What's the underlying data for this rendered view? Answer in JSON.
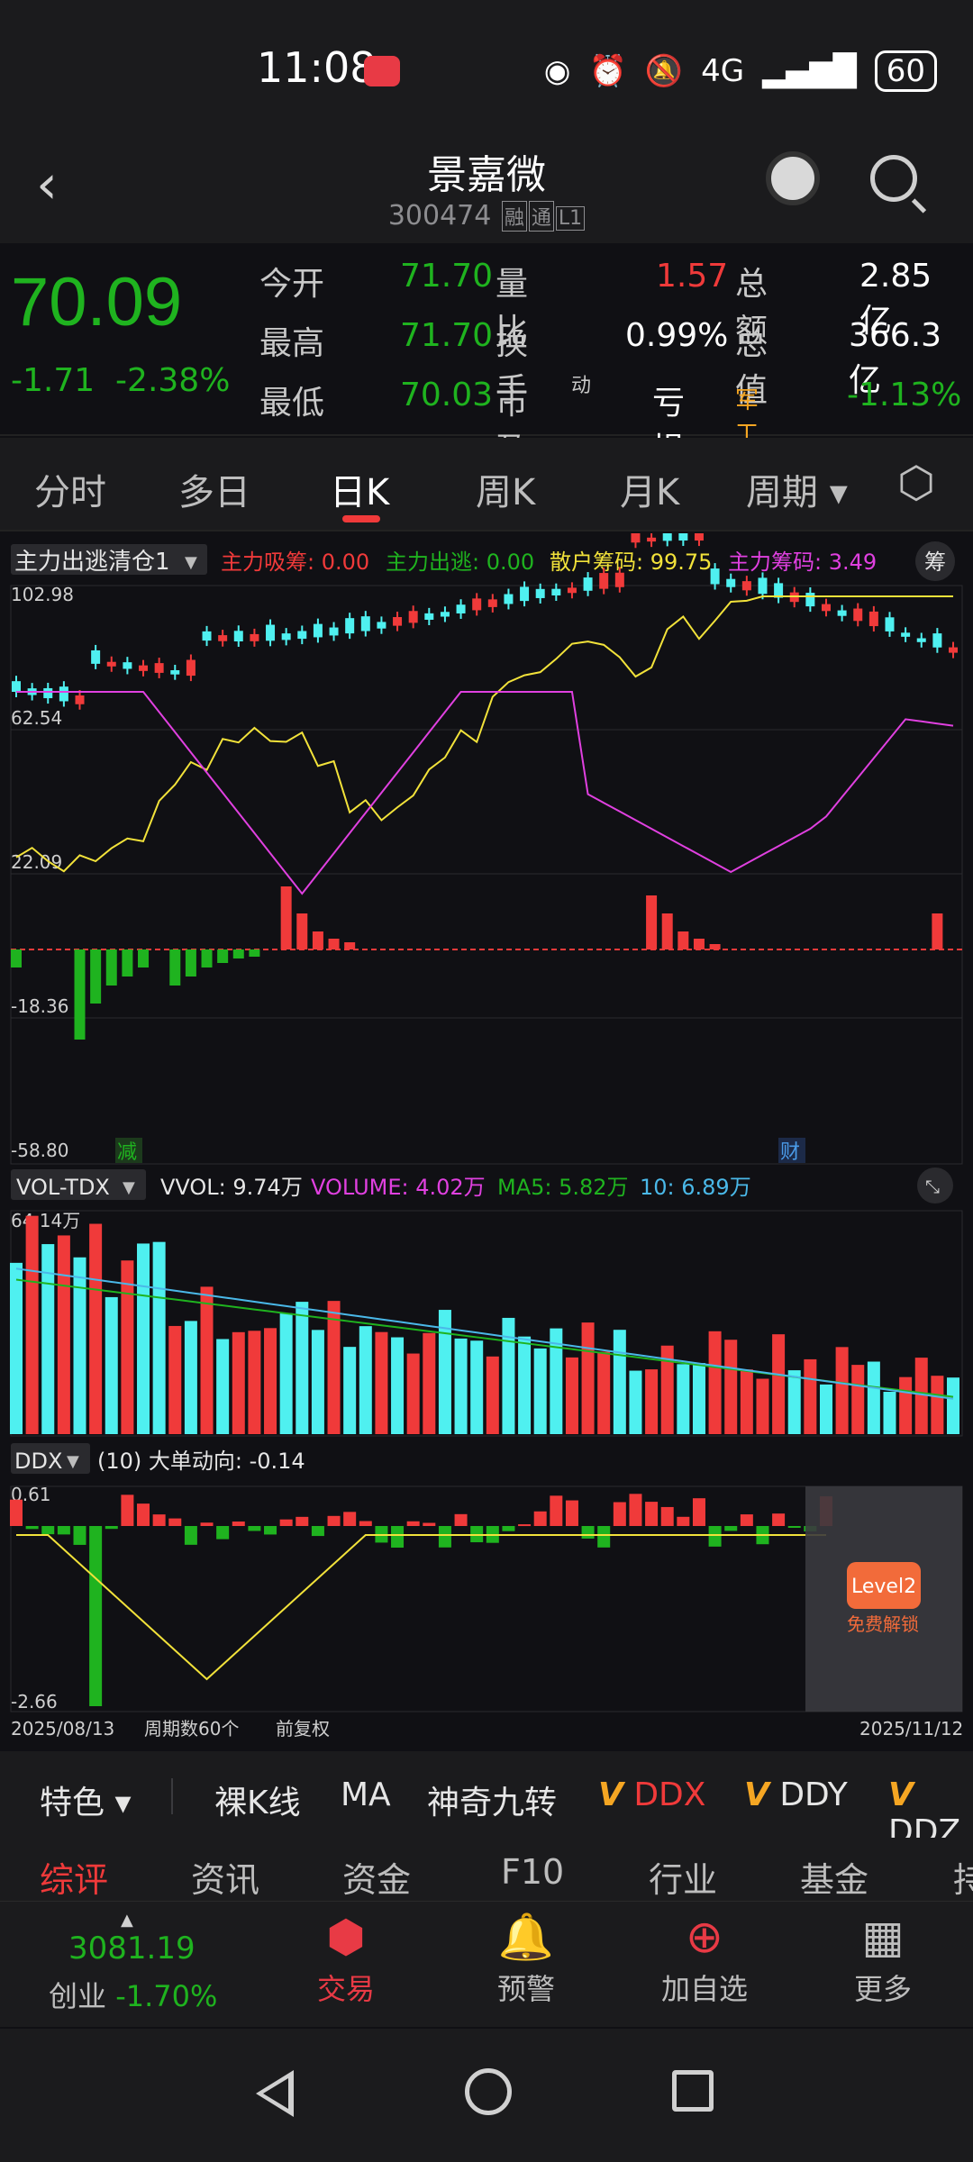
{
  "status": {
    "time": "11:08",
    "network": "4G",
    "battery": "60"
  },
  "header": {
    "title": "景嘉微",
    "code": "300474",
    "tags": [
      "融",
      "通",
      "L1"
    ]
  },
  "quote": {
    "price": "70.09",
    "change": "-1.71",
    "change_pct": "-2.38%",
    "rows": [
      {
        "l1": "今开",
        "v1": "71.70",
        "l2": "量比",
        "v2": "1.57",
        "l3": "总额",
        "v3": "2.85亿"
      },
      {
        "l1": "最高",
        "v1": "71.70",
        "l2": "换手",
        "v2": "0.99%",
        "l3": "总值",
        "v3": "366.3亿"
      },
      {
        "l1": "最低",
        "v1": "70.03",
        "l2": "市盈",
        "l2sup": "动",
        "v2": "亏损",
        "l3": "军工电子",
        "v3": "-1.13%"
      }
    ]
  },
  "tabs": [
    {
      "label": "分时"
    },
    {
      "label": "多日"
    },
    {
      "label": "日K"
    },
    {
      "label": "周K"
    },
    {
      "label": "月K"
    },
    {
      "label": "周期"
    }
  ],
  "indicator1": {
    "name": "主力出逃清仓1",
    "l1": "主力吸筹: 0.00",
    "l2": "主力出逃: 0.00",
    "l3": "散户筹码: 99.75",
    "l4": "主力筹码: 3.49",
    "chou": "筹",
    "y_labels": [
      "102.98",
      "62.54",
      "22.09",
      "-18.36",
      "-58.80"
    ],
    "marker1": "减",
    "marker2": "财"
  },
  "vol": {
    "name": "VOL-TDX",
    "vvol": "VVOL: 9.74万",
    "volume": "VOLUME: 4.02万",
    "ma5": "MA5: 5.82万",
    "ma10": "10: 6.89万",
    "top": "64.14万"
  },
  "ddx": {
    "name": "DDX",
    "desc": "(10) 大单动向: -0.14",
    "top": "0.61",
    "bottom": "-2.66",
    "level2": "Level2",
    "unlock": "免费解锁"
  },
  "footer_axis": {
    "start": "2025/08/13",
    "count": "周期数60个",
    "adj": "前复权",
    "end": "2025/11/12"
  },
  "toolbar": {
    "t1": "特色",
    "t2": "裸K线",
    "t3": "MA",
    "t4": "神奇九转",
    "t5": "DDX",
    "t6": "DDY",
    "t7": "DDZ",
    "v": "V"
  },
  "bottom_tabs": [
    "综评",
    "资讯",
    "资金",
    "F10",
    "行业",
    "基金",
    "持"
  ],
  "index": {
    "value": "3081.19",
    "name": "创业",
    "pct": "-1.70%"
  },
  "actions": [
    {
      "label": "交易"
    },
    {
      "label": "预警"
    },
    {
      "label": "加自选"
    },
    {
      "label": "更多"
    }
  ],
  "chart_data": {
    "type": "candlestick",
    "x_range": [
      "2025/08/13",
      "2025/11/12"
    ],
    "periods": 60,
    "indicator_ylim": [
      -58.8,
      102.98
    ],
    "vol_max": "64.14万",
    "ddx_ylim": [
      -2.66,
      0.61
    ],
    "legend": {
      "vvol": "9.74万",
      "volume": "4.02万",
      "ma5": "5.82万",
      "ma10": "6.89万",
      "ddx": "-0.14"
    }
  }
}
